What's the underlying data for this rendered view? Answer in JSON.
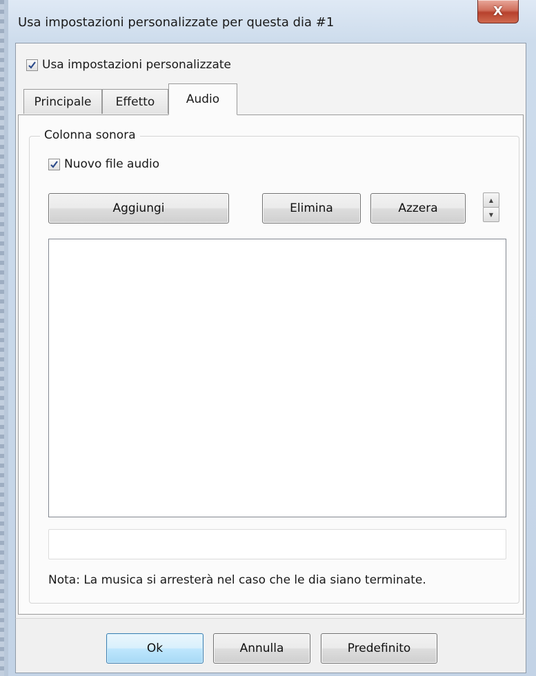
{
  "window": {
    "title": "Usa impostazioni personalizzate per questa dia #1",
    "close_glyph": "X"
  },
  "custom_settings": {
    "label": "Usa impostazioni personalizzate",
    "checked": true
  },
  "tabs": [
    {
      "label": "Principale",
      "active": false
    },
    {
      "label": "Effetto",
      "active": false
    },
    {
      "label": "Audio",
      "active": true
    }
  ],
  "soundtrack": {
    "group_label": "Colonna sonora",
    "new_audio_label": "Nuovo file audio",
    "new_audio_checked": true,
    "add_label": "Aggiungi",
    "delete_label": "Elimina",
    "reset_label": "Azzera",
    "file_list": [],
    "path_value": "",
    "note": "Nota: La musica si arresterà nel caso che le dia siano terminate."
  },
  "footer": {
    "ok_label": "Ok",
    "cancel_label": "Annulla",
    "default_label": "Predefinito"
  },
  "colors": {
    "close_button": "#c8503a",
    "default_button_border": "#3c7fb1"
  }
}
